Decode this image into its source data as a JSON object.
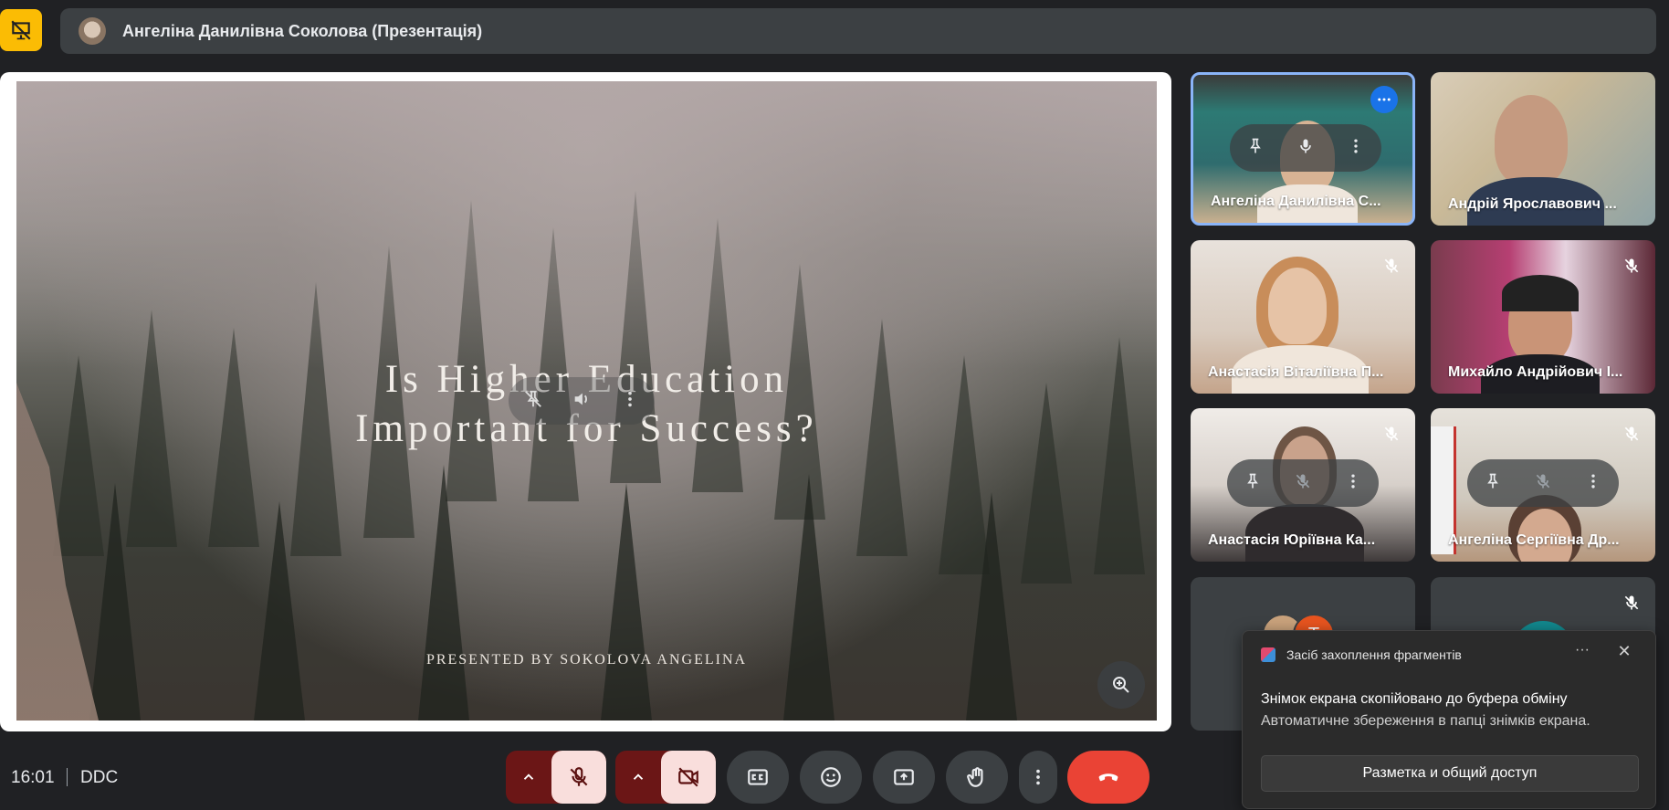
{
  "topbar": {
    "presenting_icon": "presentation-off-icon",
    "title": "Ангеліна Данилівна Соколова (Презентація)"
  },
  "slide": {
    "title_line1": "Is Higher Education",
    "title_line2": "Important for Success?",
    "subtitle": "PRESENTED BY SOKOLOVA ANGELINA"
  },
  "participants": [
    {
      "name": "Ангеліна Данилівна С...",
      "muted": false,
      "active_speaker": true
    },
    {
      "name": "Андрій Ярославович ...",
      "muted": false
    },
    {
      "name": "Анастасія Віталіївна П...",
      "muted": true
    },
    {
      "name": "Михайло Андрійович І...",
      "muted": true
    },
    {
      "name": "Анастасія Юріївна Ка...",
      "muted": true
    },
    {
      "name": "Ангеліна Сергіївна Др...",
      "muted": true
    },
    {
      "name": "",
      "initial": "T",
      "muted": false
    },
    {
      "name": "",
      "muted": true
    }
  ],
  "toast": {
    "app_name": "Засіб захоплення фрагментів",
    "more": "···",
    "close": "✕",
    "heading": "Знімок екрана скопійовано до буфера обміну",
    "body": "Автоматичне збереження в папці знімків екрана.",
    "action": "Разметка и общий доступ"
  },
  "bottombar": {
    "time": "16:01",
    "meeting_code": "DDC"
  },
  "colors": {
    "accent_blue": "#8ab4f8",
    "leave_red": "#ea4335",
    "present_yellow": "#fbbc04",
    "off_button_bg": "#f9dedc"
  }
}
